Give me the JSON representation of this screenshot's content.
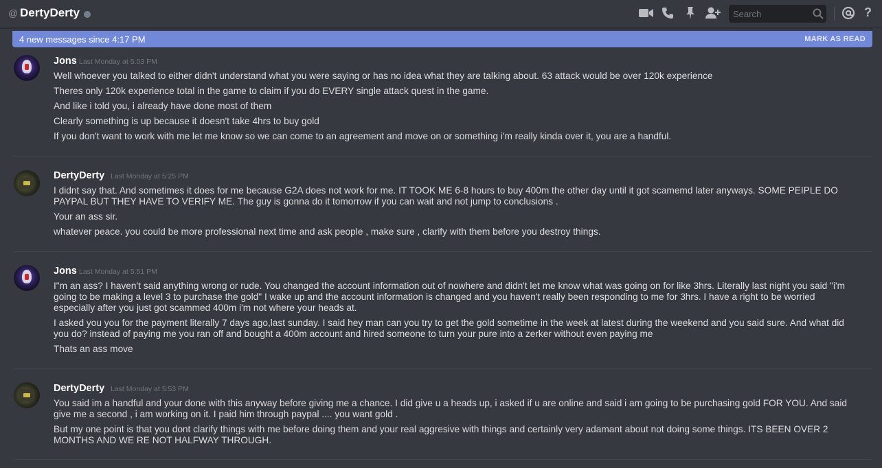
{
  "header": {
    "at": "@",
    "channel_name": "DertyDerty",
    "search_placeholder": "Search",
    "icons": [
      "video-camera-icon",
      "phone-icon",
      "pin-icon",
      "add-friend-icon",
      "search-icon",
      "mention-icon",
      "help-icon"
    ]
  },
  "banner": {
    "text": "4 new messages since 4:17 PM",
    "action": "MARK AS READ",
    "color": "#7289da"
  },
  "groups": [
    {
      "username": "Jons",
      "timestamp": "Last Monday at 5:03 PM",
      "messages": [
        "Well whoever you talked to either didn't understand what you were saying or has no idea what they are talking about. 63 attack would be over 120k experience",
        "Theres only 120k experience total in the game to claim if you do EVERY single attack quest in the game.",
        "And like i told you, i already have done most of them",
        "Clearly something is up because it doesn't take 4hrs to buy gold",
        "If you don't want to work with me let me know so we can come to an agreement and move on or something i'm really kinda over it, you are a handful."
      ]
    },
    {
      "username": "DertyDerty",
      "timestamp": "Last Monday at 5:25 PM",
      "messages": [
        "I didnt say that. And sometimes it does for me because G2A does not work for me. IT TOOK ME 6-8 hours to buy 400m the other day until it got scamemd later anyways. SOME PEIPLE DO PAYPAL BUT THEY HAVE TO VERIFY ME. The guy is gonna do it tomorrow if you can wait and not jump to conclusions .",
        "Your an ass sir.",
        "whatever peace. you could be more professional next time and ask people , make sure , clarify with them before you destroy things."
      ]
    },
    {
      "username": "Jons",
      "timestamp": "Last Monday at 5:51 PM",
      "messages": [
        "I\"m an ass? I haven't said anything wrong or rude. You changed the account information out of nowhere and didn't let me know what was going on for like 3hrs. Literally last night you said \"i'm going to be making a level 3 to purchase the gold\" I wake up and the account information is changed and you haven't really been responding to me for 3hrs. I have a right to be worried especially after you just got scammed 400m i'm not where your heads at.",
        "I asked you you for the payment literally 7 days ago,last sunday. I said hey man can you try to get the gold sometime in the week at latest during the weekend and you said sure. And what did you do? instead of paying me you ran off and bought a 400m account and hired someone to turn your pure into a zerker without even paying me",
        "Thats an ass move"
      ]
    },
    {
      "username": "DertyDerty",
      "timestamp": "Last Monday at 5:53 PM",
      "messages": [
        "You said im a handful and your done with this anyway before giving me a chance. I did give u a heads up, i asked if u are online and said i am going to be purchasing gold FOR YOU. And said give me a second , i am working on it. I paid him through paypal .... you want gold .",
        "But my one point is that you dont clarify things with me before doing them and your real aggresive with things and certainly very adamant about not doing some things. ITS BEEN OVER 2 MONTHS AND WE RE NOT HALFWAY THROUGH."
      ]
    }
  ]
}
